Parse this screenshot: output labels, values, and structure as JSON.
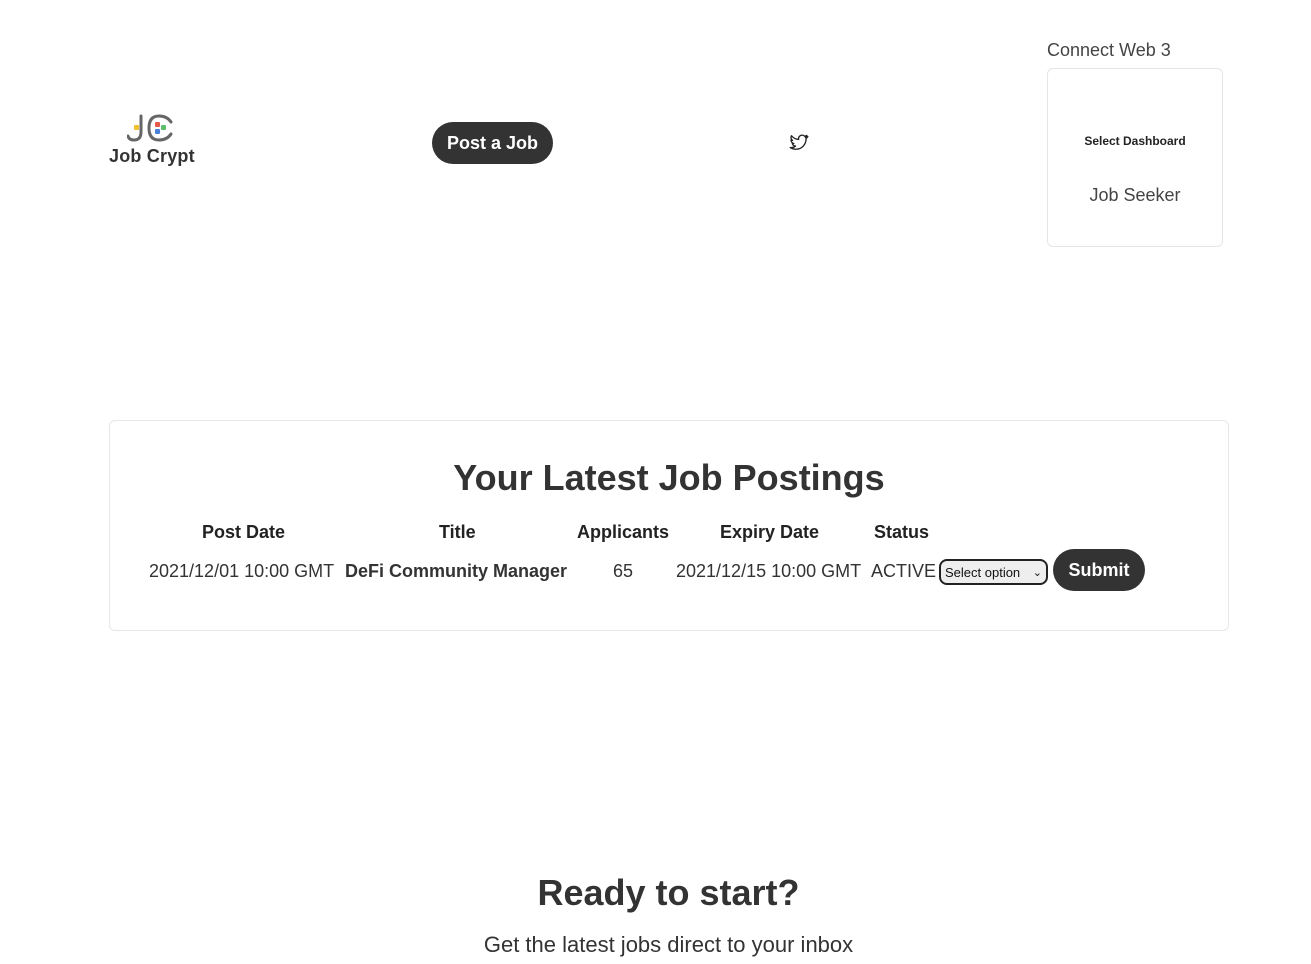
{
  "header": {
    "logo_text": "Job Crypt",
    "post_job_label": "Post a Job",
    "connect_label": "Connect Web 3",
    "dashboard": {
      "title": "Select Dashboard",
      "option": "Job Seeker"
    }
  },
  "postings": {
    "title": "Your Latest Job Postings",
    "columns": [
      "Post Date",
      "Title",
      "Applicants",
      "Expiry Date",
      "Status"
    ],
    "rows": [
      {
        "post_date": "2021/12/01 10:00 GMT",
        "title": "DeFi Community Manager",
        "applicants": "65",
        "expiry_date": "2021/12/15 10:00 GMT",
        "status": "ACTIVE",
        "select_value": "Select option",
        "submit_label": "Submit"
      }
    ]
  },
  "cta": {
    "title": "Ready to start?",
    "subtitle": "Get the latest jobs direct to your inbox"
  },
  "colors": {
    "button_bg": "#333333",
    "text": "#333333",
    "logo_yellow": "#f2c12e",
    "logo_red": "#e8584a",
    "logo_blue": "#4a7fd9",
    "logo_green": "#5cbf6b"
  }
}
